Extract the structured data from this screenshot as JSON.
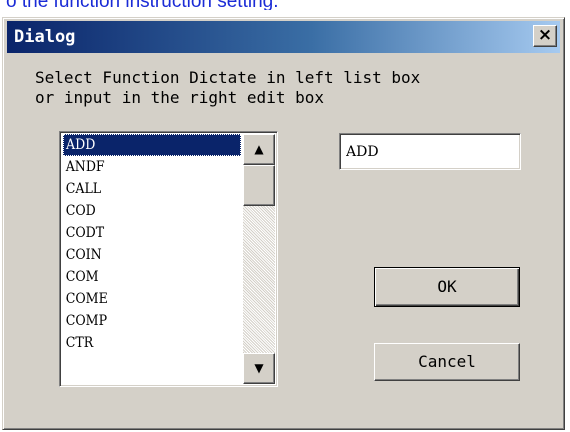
{
  "caption": "o the function instruction setting.",
  "dialog": {
    "title": "Dialog",
    "close_label": "×",
    "instructions": [
      "Select Function Dictate in left list box",
      "or input in the right edit box"
    ]
  },
  "listbox": {
    "items": [
      "ADD",
      "ANDF",
      "CALL",
      "COD",
      "CODT",
      "COIN",
      "COM",
      "COME",
      "COMP",
      "CTR"
    ],
    "selected_index": 0,
    "scroll_up_label": "▲",
    "scroll_down_label": "▼"
  },
  "edit": {
    "value": "ADD"
  },
  "buttons": {
    "ok_label": "OK",
    "cancel_label": "Cancel"
  },
  "colors": {
    "caption_text": "#1a2bd6",
    "title_bar_start": "#0a246a",
    "title_bar_end": "#a6caf0",
    "dialog_face": "#d4d0c8",
    "selection": "#0a246a"
  }
}
